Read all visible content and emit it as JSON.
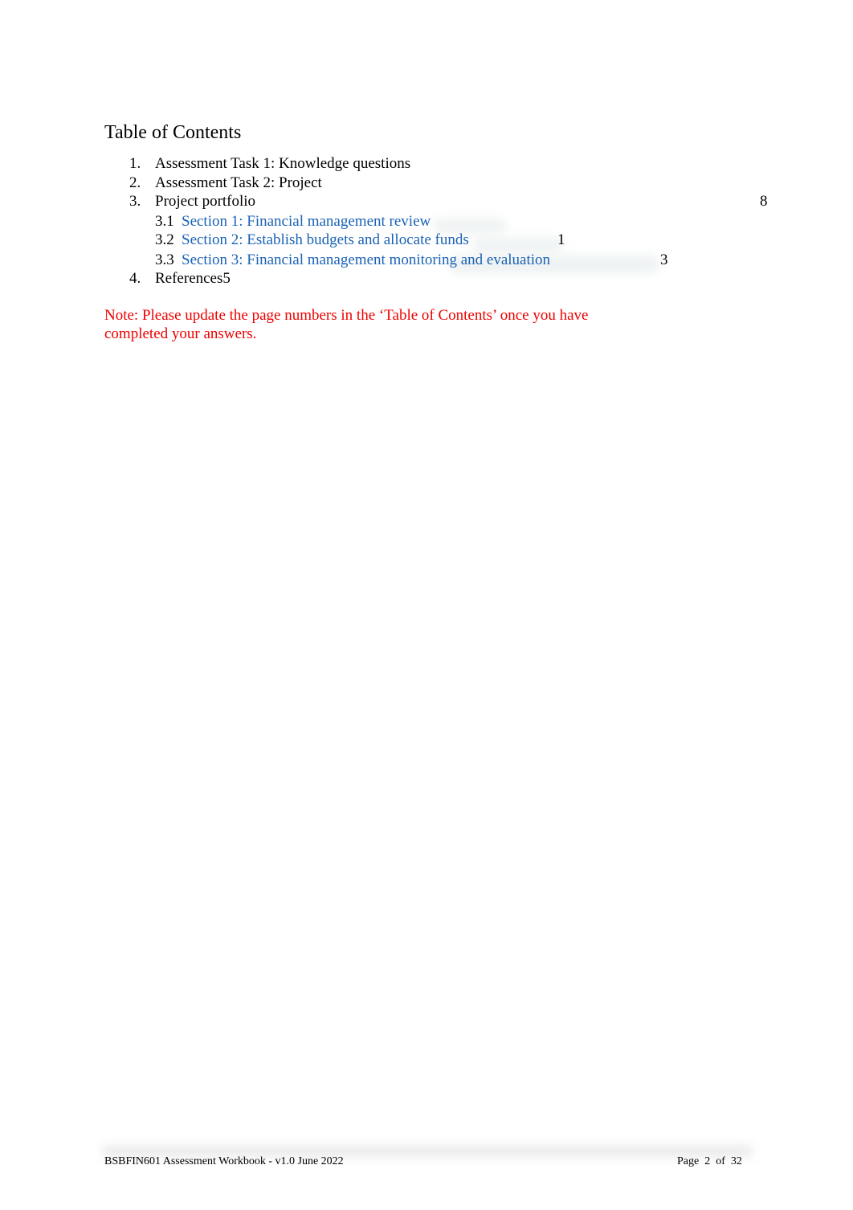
{
  "toc": {
    "title": "Table of Contents",
    "items": [
      {
        "number": "1.",
        "label": "Assessment Task 1: Knowledge questions",
        "page": ""
      },
      {
        "number": "2.",
        "label": "Assessment Task 2: Project",
        "page": ""
      },
      {
        "number": "3.",
        "label": "Project portfolio",
        "page": "8"
      },
      {
        "number": "4.",
        "label": "References5",
        "page": ""
      }
    ],
    "subitems": [
      {
        "number": "3.1",
        "label": "Section 1: Financial management review",
        "page": ""
      },
      {
        "number": "3.2",
        "label": "Section 2: Establish budgets and allocate funds",
        "page": "1"
      },
      {
        "number": "3.3",
        "label": "Section 3: Financial management monitoring and evaluation",
        "page": "3"
      }
    ]
  },
  "note": "Note: Please update the page numbers in the ‘Table of Contents’ once you have completed your answers.",
  "footer": {
    "document": "BSBFIN601 Assessment Workbook - v1.0 June 2022",
    "page_label": "Page",
    "page_number": "2",
    "of_label": "of",
    "total_pages": "32"
  },
  "colors": {
    "link": "#1a62b5",
    "note": "#ee0000"
  }
}
